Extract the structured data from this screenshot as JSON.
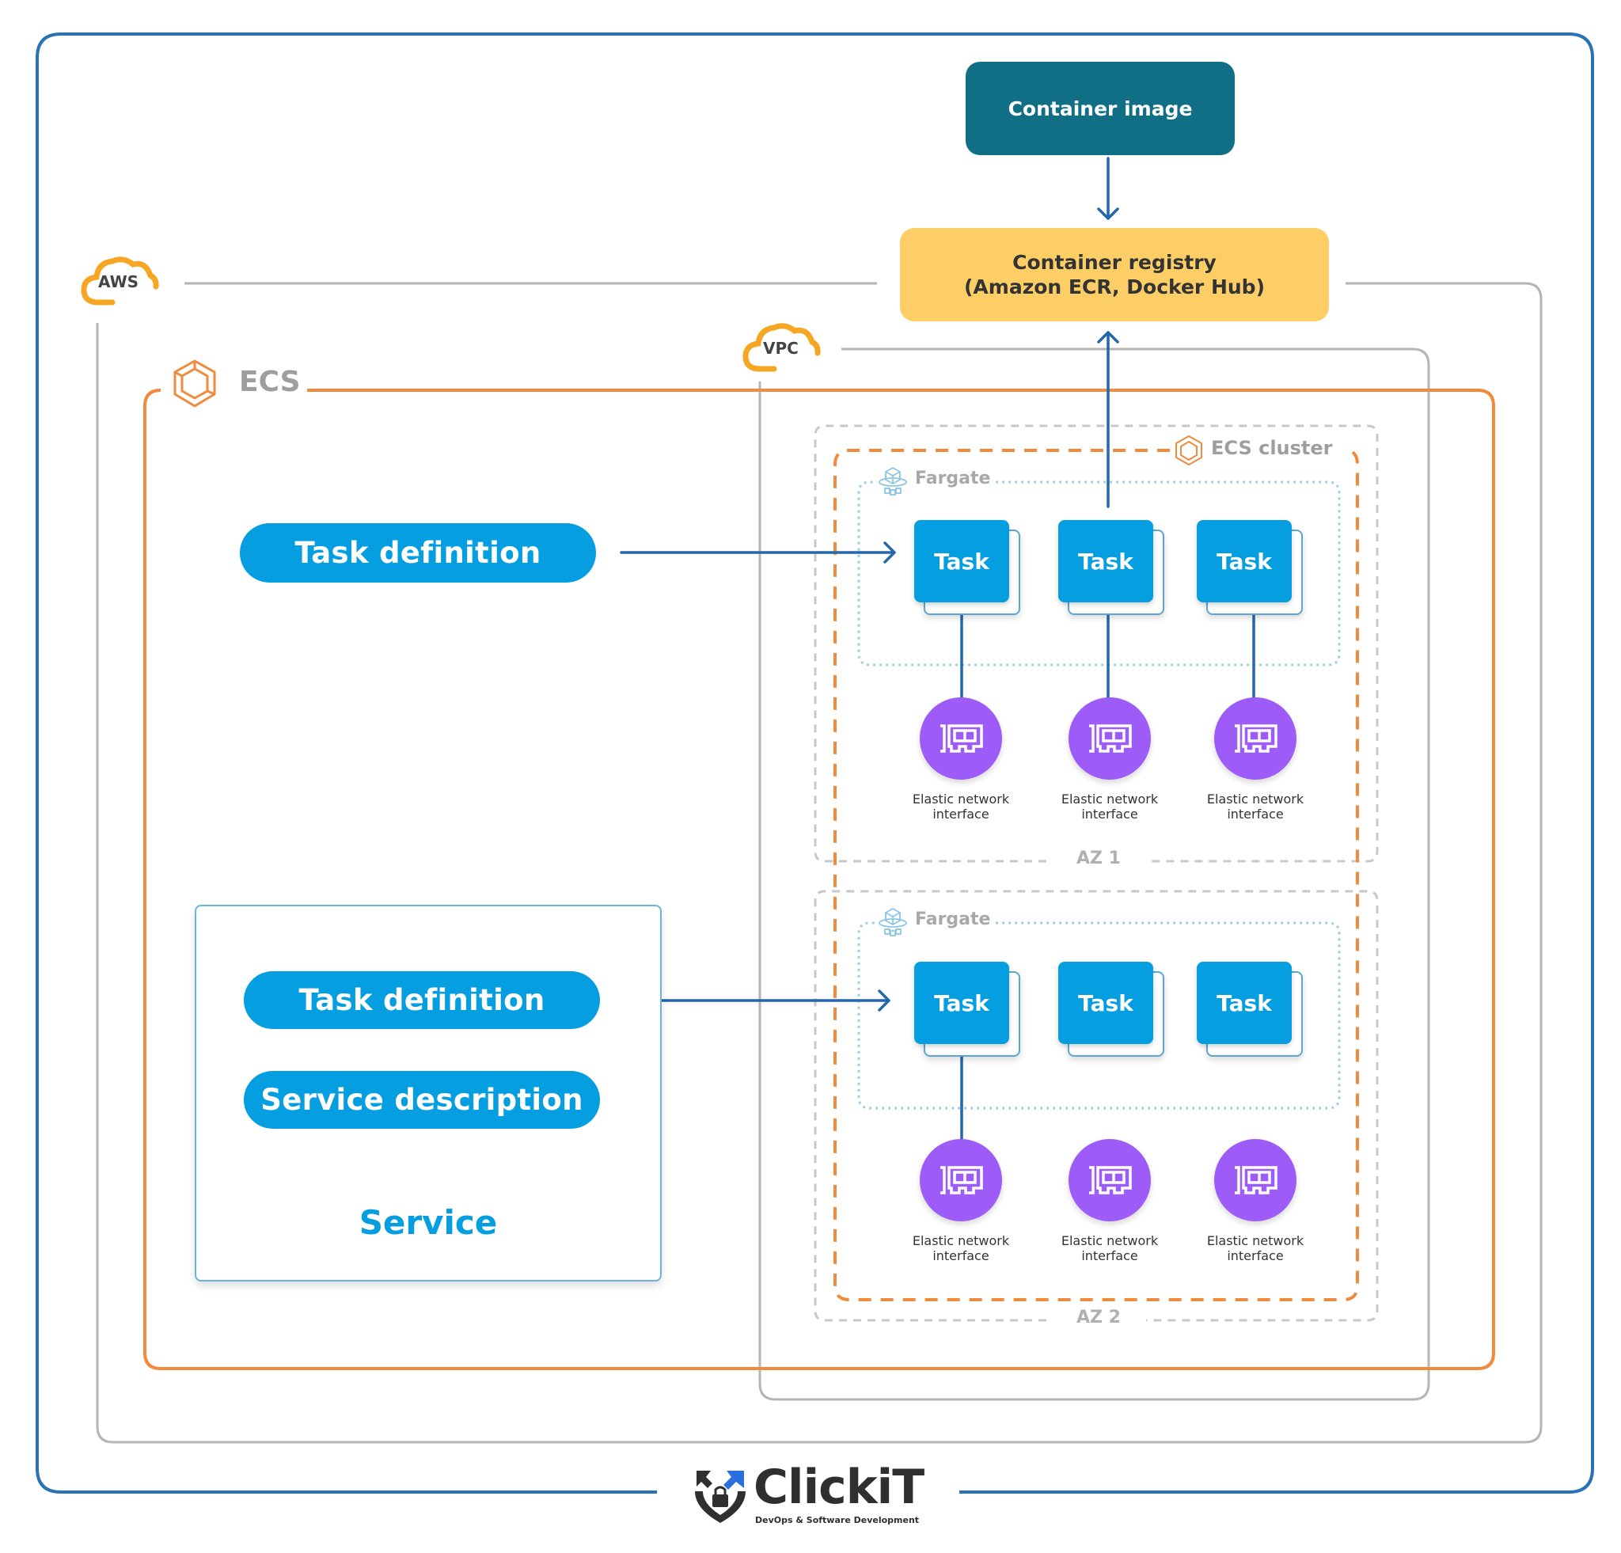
{
  "colors": {
    "frame_blue": "#2a72b8",
    "aws_gray": "#b5b5b5",
    "ecs_orange": "#f08a3c",
    "cloud_orange": "#f6a623",
    "container_image_bg": "#116f85",
    "registry_bg": "#fdcd66",
    "task_blue": "#049ee1",
    "eni_purple": "#9d5cf7",
    "arrow_blue": "#2467ad",
    "fargate_dotted": "#9fcde3"
  },
  "container_image": {
    "label": "Container image"
  },
  "registry": {
    "line1": "Container registry",
    "line2": "(Amazon ECR, Docker Hub)"
  },
  "aws": {
    "label": "AWS",
    "icon": "cloud-icon"
  },
  "vpc": {
    "label": "VPC",
    "icon": "cloud-icon"
  },
  "ecs": {
    "label": "ECS",
    "icon": "ecs-hexagon-icon"
  },
  "ecs_cluster": {
    "label": "ECS cluster",
    "icon": "ecs-hexagon-icon"
  },
  "task_definition_top": {
    "label": "Task definition"
  },
  "service": {
    "title": "Service",
    "task_definition": "Task definition",
    "service_description": "Service description"
  },
  "availability_zones": [
    {
      "label": "AZ 1",
      "fargate_label": "Fargate",
      "tasks": [
        {
          "label": "Task"
        },
        {
          "label": "Task"
        },
        {
          "label": "Task"
        }
      ],
      "enis": [
        {
          "line1": "Elastic network",
          "line2": "interface"
        },
        {
          "line1": "Elastic network",
          "line2": "interface"
        },
        {
          "line1": "Elastic network",
          "line2": "interface"
        }
      ]
    },
    {
      "label": "AZ 2",
      "fargate_label": "Fargate",
      "tasks": [
        {
          "label": "Task"
        },
        {
          "label": "Task"
        },
        {
          "label": "Task"
        }
      ],
      "enis": [
        {
          "line1": "Elastic network",
          "line2": "interface"
        },
        {
          "line1": "Elastic network",
          "line2": "interface"
        },
        {
          "line1": "Elastic network",
          "line2": "interface"
        }
      ]
    }
  ],
  "logo": {
    "name_main": "Click",
    "name_accent": "iT",
    "tagline": "DevOps & Software Development"
  }
}
